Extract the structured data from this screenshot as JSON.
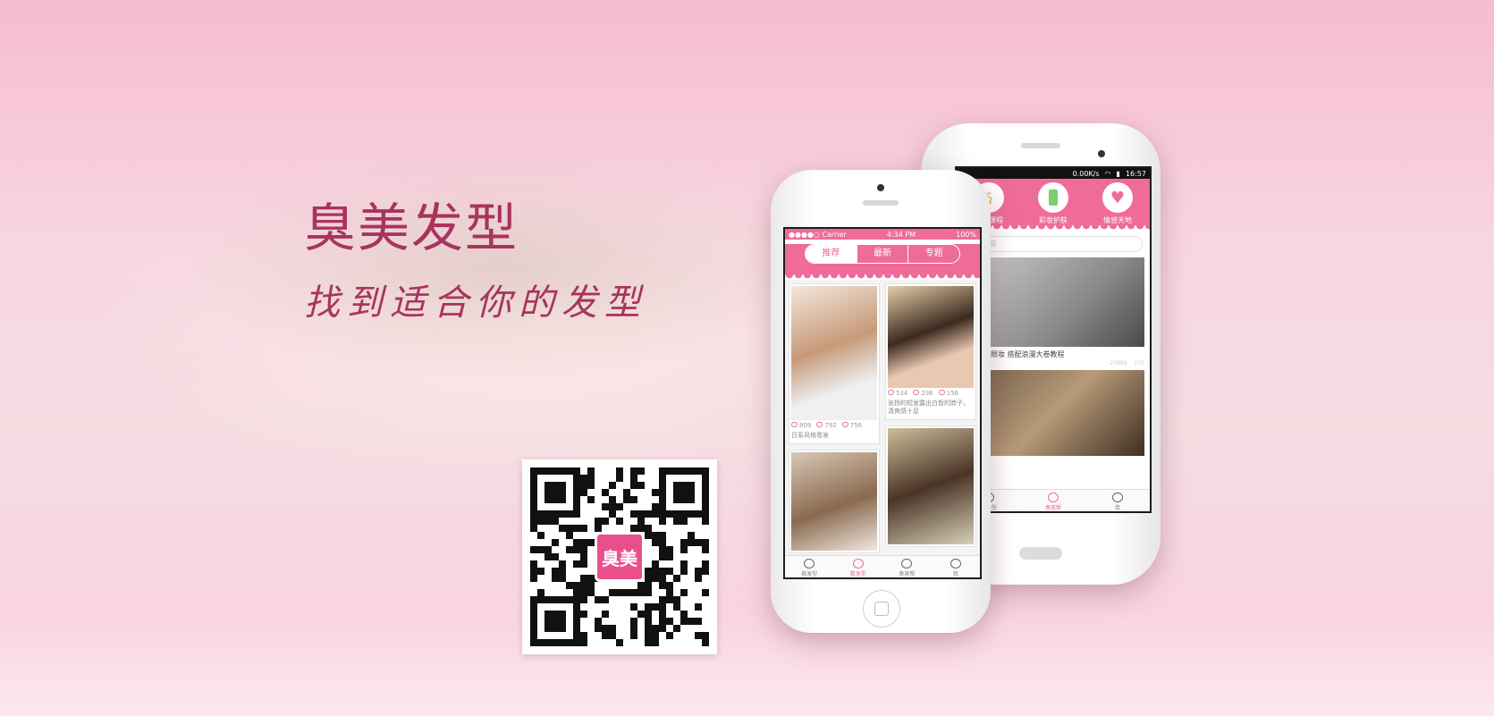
{
  "hero": {
    "title": "臭美发型",
    "subtitle": "找到适合你的发型"
  },
  "qr": {
    "logo_text": "臭美"
  },
  "iphone": {
    "status": {
      "carrier": "●●●●○ Carrier",
      "time": "4:34 PM",
      "battery": "100%"
    },
    "tabs": [
      "推荐",
      "最新",
      "专题"
    ],
    "cards_left": [
      {
        "views": "809",
        "likes": "792",
        "comments": "756",
        "caption": "日系风格卷发"
      },
      {
        "views": "",
        "likes": "",
        "comments": "",
        "caption": ""
      }
    ],
    "cards_right": [
      {
        "views": "534",
        "likes": "236",
        "comments": "156",
        "caption": "张扬的短发露出白皙的脖子，清爽感十足"
      },
      {
        "views": "",
        "likes": "",
        "comments": "",
        "caption": ""
      }
    ],
    "tabbar": [
      {
        "label": "换发型",
        "icon": "refresh-icon"
      },
      {
        "label": "看发型",
        "icon": "swirl-icon",
        "active": true
      },
      {
        "label": "臭美帮",
        "icon": "eye-icon"
      },
      {
        "label": "我",
        "icon": "user-icon"
      }
    ]
  },
  "android": {
    "status": {
      "speed": "0.00K/s",
      "time": "16:57"
    },
    "categories": [
      {
        "label": "编发课程",
        "icon": "hair-icon"
      },
      {
        "label": "彩妆护肤",
        "icon": "cosmetic-icon"
      },
      {
        "label": "情感天地",
        "icon": "heart-icon"
      }
    ],
    "search_placeholder": "...的内容",
    "feed": [
      {
        "title": "…甜美大眼妆 搭配浪漫大卷教程",
        "views": "23889",
        "comments": "272"
      }
    ],
    "tabbar": [
      {
        "label": "看发型",
        "icon": "swirl-icon"
      },
      {
        "label": "臭美帮",
        "icon": "eye-icon",
        "active": true
      },
      {
        "label": "我",
        "icon": "user-icon"
      }
    ]
  },
  "colors": {
    "accent": "#ee6b9a",
    "title": "#a8345e"
  }
}
